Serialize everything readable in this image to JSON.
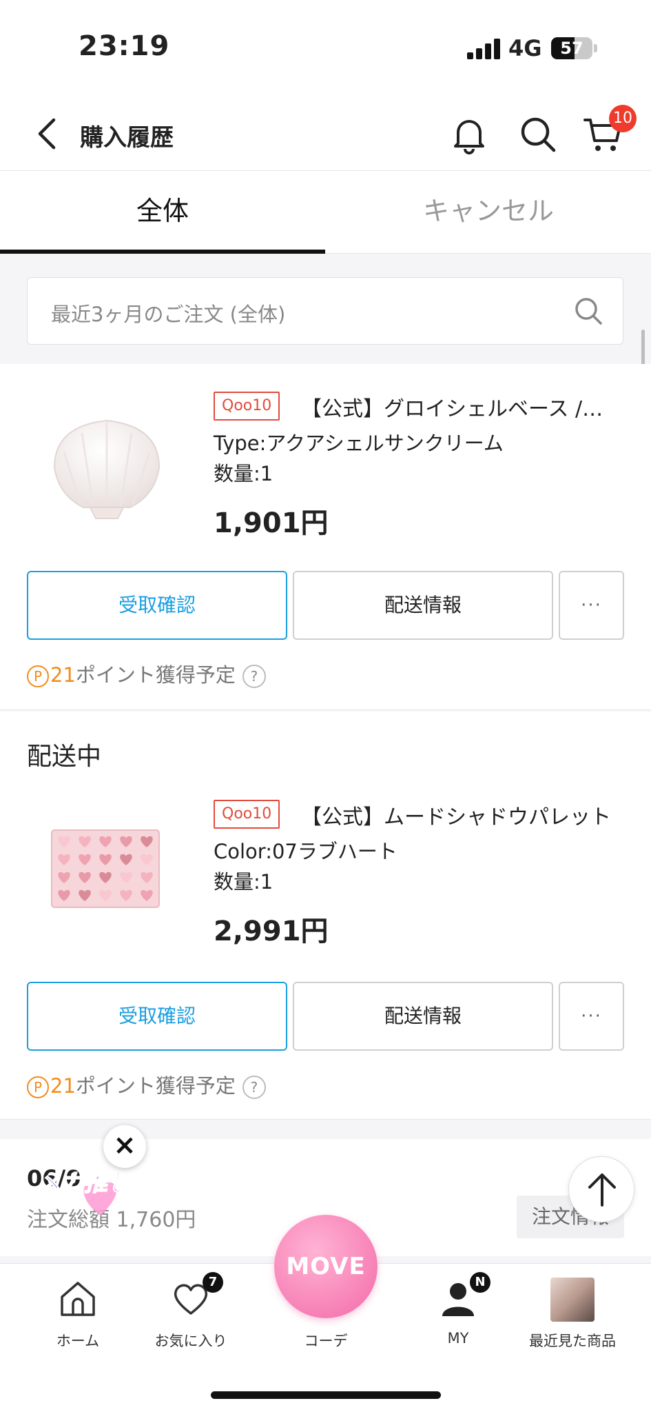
{
  "status_bar": {
    "time": "23:19",
    "network": "4G",
    "battery": "57",
    "battery_level": 0.57
  },
  "header": {
    "title": "購入履歴",
    "cart_count": "10"
  },
  "tabs": [
    {
      "label": "全体",
      "active": true
    },
    {
      "label": "キャンセル",
      "active": false
    }
  ],
  "search": {
    "placeholder": "最近3ヶ月のご注文 (全体)"
  },
  "orders": [
    {
      "status": "",
      "shop_badge": "Qoo10",
      "name": "【公式】グロイシェルベース /アクアシェルサンクリーム",
      "option": "Type:アクアシェルサンクリーム",
      "qty": "数量:1",
      "price": "1,901円",
      "btn_confirm": "受取確認",
      "btn_ship": "配送情報",
      "btn_more": "···",
      "points_icon": "P",
      "points_num": "21",
      "points_text": "ポイント獲得予定",
      "help": "?"
    },
    {
      "status": "配送中",
      "shop_badge": "Qoo10",
      "name": "【公式】ムードシャドウパレット",
      "option": "Color:07ラブハート",
      "qty": "数量:1",
      "price": "2,991円",
      "btn_confirm": "受取確認",
      "btn_ship": "配送情報",
      "btn_more": "···",
      "points_icon": "P",
      "points_num": "21",
      "points_text": "ポイント獲得予定",
      "help": "?"
    }
  ],
  "order3": {
    "date": "06/0",
    "total": "注文総額 1,760円",
    "info_btn": "注文情報"
  },
  "floating": {
    "mega": "メガ推し",
    "close": "×"
  },
  "tabbar": {
    "home": "ホーム",
    "favorites": "お気に入り",
    "favorites_badge": "7",
    "move": "MOVE",
    "coordi": "コーデ",
    "my": "MY",
    "my_badge": "N",
    "recent": "最近見た商品"
  },
  "colors": {
    "accent": "#1a9ee0",
    "badge_red": "#ee3b2b",
    "qoo10_red": "#e14b3c",
    "points": "#f28c1b",
    "move_pink": "#f36aa8"
  }
}
